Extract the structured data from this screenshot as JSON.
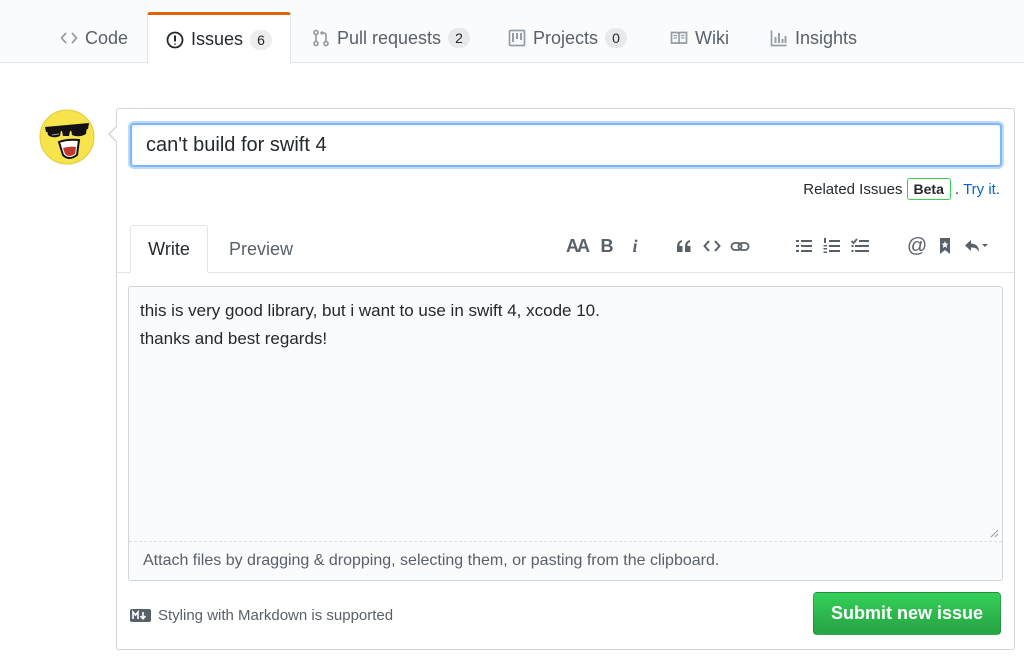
{
  "repo_nav": {
    "tabs": [
      {
        "label": "Code",
        "icon": "code-icon"
      },
      {
        "label": "Issues",
        "icon": "issue-opened-icon",
        "count": "6",
        "selected": true
      },
      {
        "label": "Pull requests",
        "icon": "git-pull-request-icon",
        "count": "2"
      },
      {
        "label": "Projects",
        "icon": "project-icon",
        "count": "0"
      },
      {
        "label": "Wiki",
        "icon": "book-icon"
      },
      {
        "label": "Insights",
        "icon": "graph-icon"
      }
    ],
    "selected_border_color": "#e36209"
  },
  "issue_form": {
    "title_value": "can't build for swift 4",
    "related_label": "Related Issues",
    "beta_label": "Beta",
    "try_it_label": "Try it.",
    "tabs": {
      "write": "Write",
      "preview": "Preview"
    },
    "toolbar": {
      "header": "AA",
      "bold": "B",
      "italic": "i",
      "icons": [
        "text-size-icon",
        "bold-icon",
        "italic-icon",
        "quote-icon",
        "code-icon",
        "link-icon",
        "unordered-list-icon",
        "ordered-list-icon",
        "tasklist-icon",
        "mention-icon",
        "bookmark-icon",
        "reply-icon"
      ]
    },
    "body_text": "this is very good library, but i want to use in swift 4, xcode 10.\nthanks and best regards!",
    "attach_hint": "Attach files by dragging & dropping, selecting them, or pasting from the clipboard.",
    "markdown_note": "Styling with Markdown is supported",
    "submit_label": "Submit new issue",
    "submit_color": "#28a745",
    "focus_color": "#79b8ff"
  }
}
